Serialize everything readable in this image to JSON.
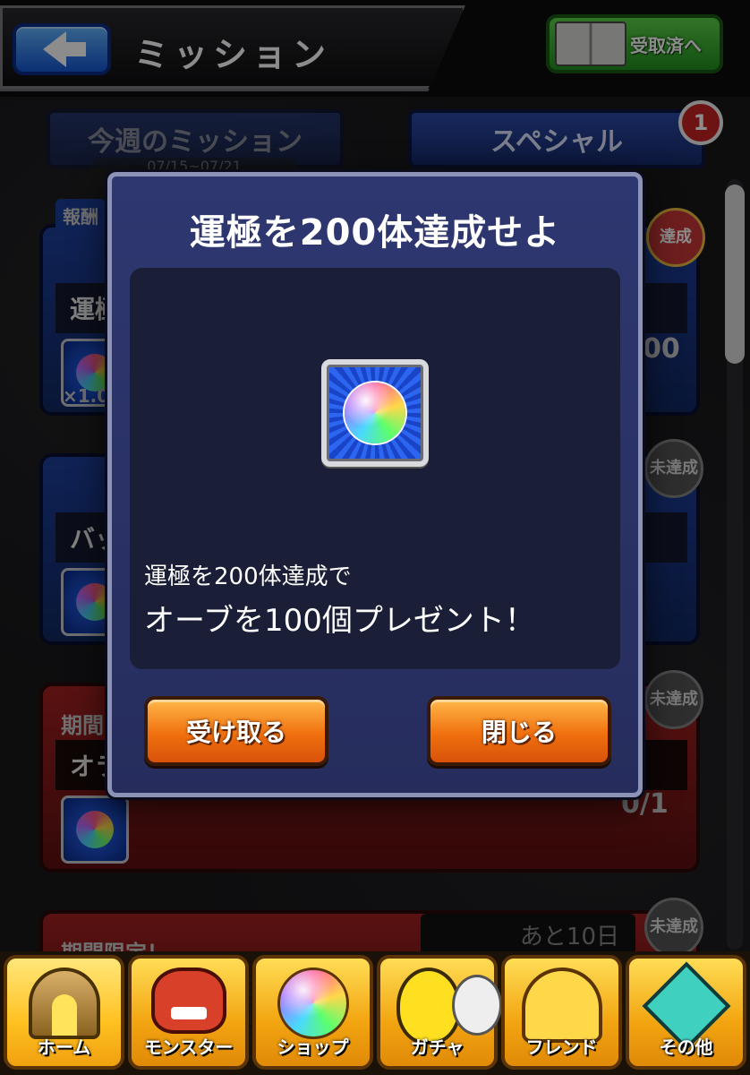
{
  "header": {
    "title": "ミッション",
    "received_label": "受取済へ"
  },
  "tabs": [
    {
      "label": "今週のミッション",
      "dates": "07/15~07/21"
    },
    {
      "label": "スペシャル",
      "badge": "1"
    }
  ],
  "background": {
    "card1_title": "運極",
    "card1_reward_qty": "×1.0",
    "card1_side": "報酬",
    "card1_value": "00",
    "card2_title": "バッ",
    "card3_header": "期間",
    "card3_title": "オラ",
    "card3_progress": "0/1",
    "card4_header": "期間限定！",
    "card4_remaining": "あと10日",
    "stamp_done": "達成",
    "stamp_pending": "未達成"
  },
  "modal": {
    "title": "運極を200体達成せよ",
    "reward_icon": "rainbow-orb",
    "desc_line1": "運極を200体達成で",
    "desc_line2": "オーブを100個プレゼント！",
    "receive_label": "受け取る",
    "close_label": "閉じる"
  },
  "nav": [
    {
      "label": "ホーム",
      "icon": "home-gate"
    },
    {
      "label": "モンスター",
      "icon": "monster"
    },
    {
      "label": "ショップ",
      "icon": "orb"
    },
    {
      "label": "ガチャ",
      "icon": "egg"
    },
    {
      "label": "フレンド",
      "icon": "friends"
    },
    {
      "label": "その他",
      "icon": "question"
    }
  ],
  "colors": {
    "accent_orange": "#f0700e",
    "modal_bg": "#2e3770",
    "panel_bg": "#1a1e36",
    "nav_gold": "#f2a410"
  }
}
